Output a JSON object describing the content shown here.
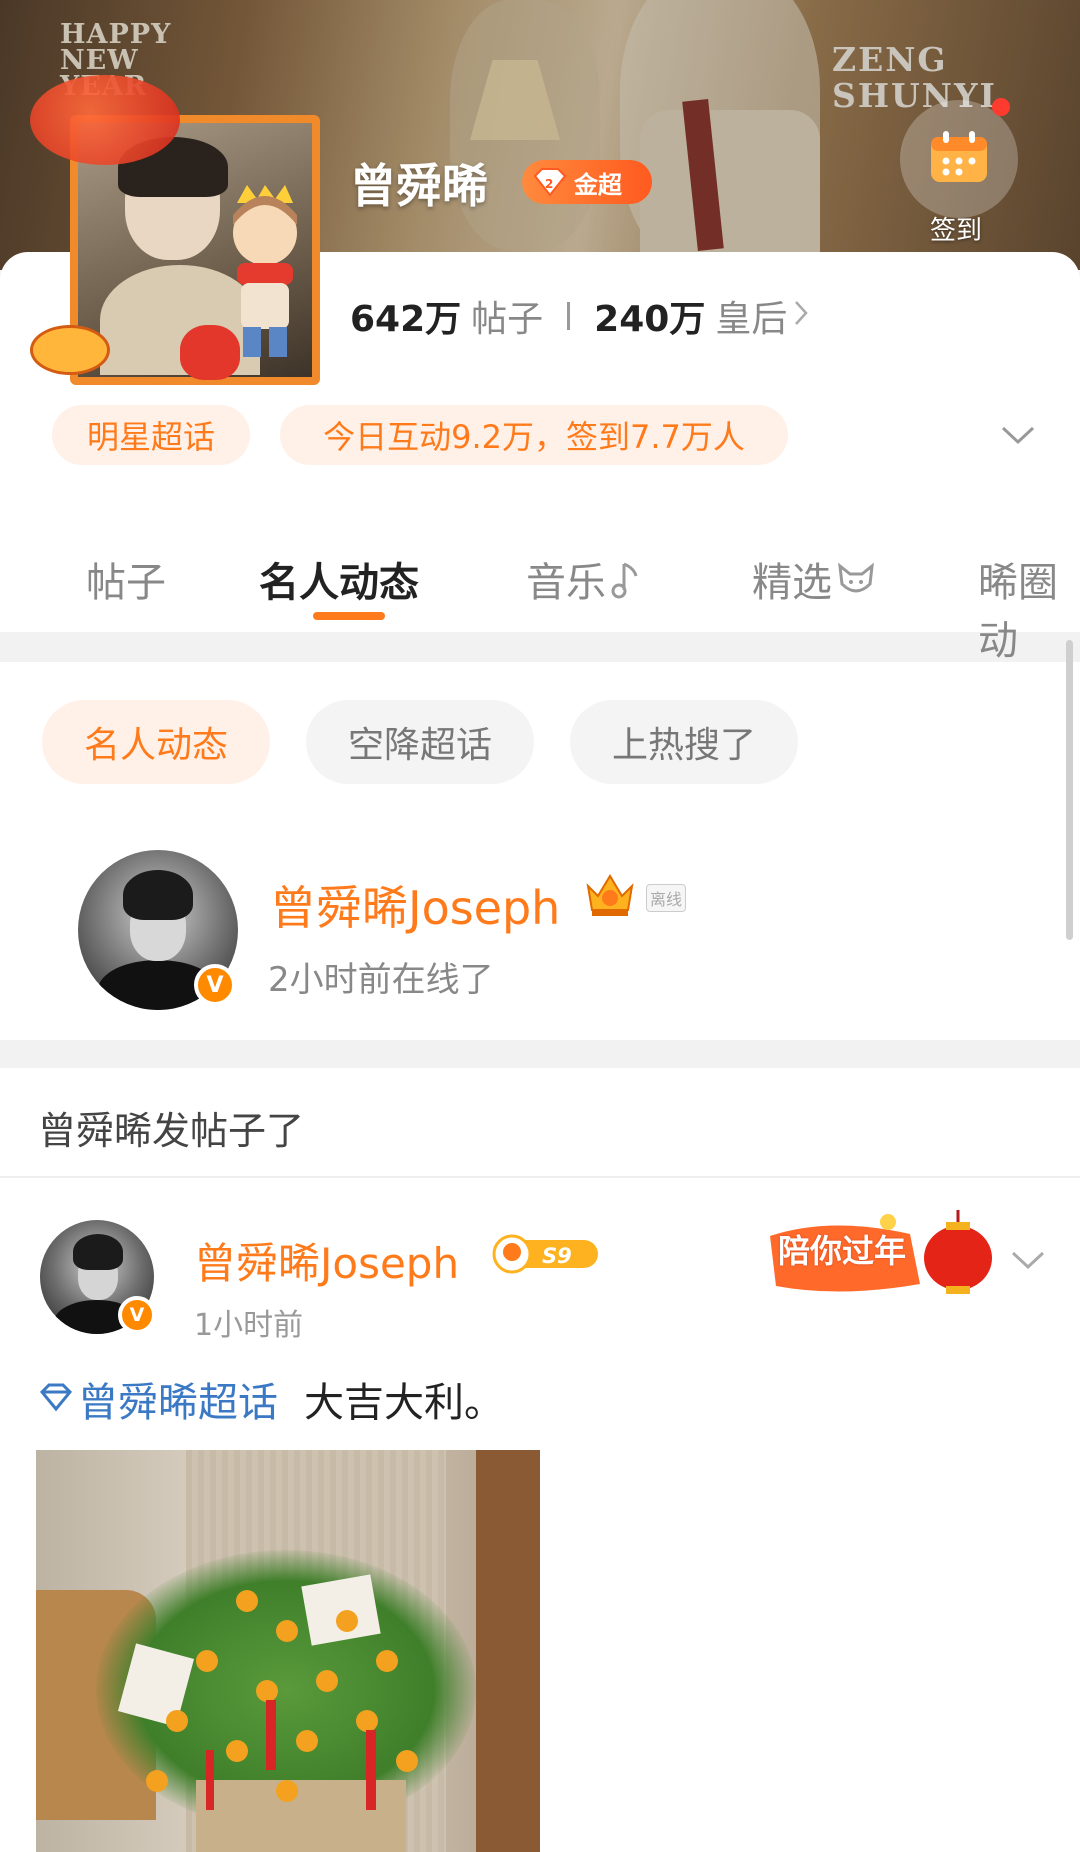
{
  "header": {
    "banner_text_left": "HAPPY NEW YEAR",
    "banner_text_right_line1": "ZENG",
    "banner_text_right_line2": "SHUNYI",
    "title": "曾舜晞",
    "badge_label": "金超",
    "checkin_label": "签到"
  },
  "stats": {
    "posts_value": "642万",
    "posts_label": "帖子",
    "members_value": "240万",
    "members_label": "皇后"
  },
  "tags": {
    "category": "明星超话",
    "activity": "今日互动9.2万，签到7.7万人"
  },
  "tabs": [
    {
      "label": "帖子",
      "active": false
    },
    {
      "label": "名人动态",
      "active": true
    },
    {
      "label": "音乐",
      "active": false,
      "icon": "music-note-icon"
    },
    {
      "label": "精选",
      "active": false,
      "icon": "fox-icon"
    },
    {
      "label": "晞圈动",
      "active": false
    }
  ],
  "filter_chips": [
    "名人动态",
    "空降超话",
    "上热搜了"
  ],
  "celebrity": {
    "name": "曾舜晞Joseph",
    "offline_label": "离线",
    "status": "2小时前在线了"
  },
  "feed": {
    "section_title": "曾舜晞发帖子了",
    "post": {
      "author": "曾舜晞Joseph",
      "level_badge": "S9",
      "time": "1小时前",
      "festive_label": "陪你过年",
      "topic": "曾舜晞超话",
      "text": "大吉大利。"
    }
  },
  "colors": {
    "accent": "#ff7a1a",
    "link": "#3b79c4",
    "pill_bg": "#fff1e8"
  }
}
